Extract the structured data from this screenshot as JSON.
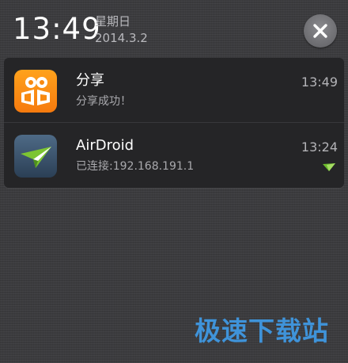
{
  "status": {
    "time": "13:49",
    "weekday": "星期日",
    "date": "2014.3.2"
  },
  "notifications": [
    {
      "app_icon": "kuaibo-share-icon",
      "title": "分享",
      "text": "分享成功！",
      "time": "13:49"
    },
    {
      "app_icon": "airdroid-paper-plane-icon",
      "title": "AirDroid",
      "text": "已连接:192.168.191.1",
      "time": "13:24"
    }
  ],
  "colors": {
    "background": "#3b3b3e",
    "panel": "#252527",
    "share_icon_orange": "#f8890f",
    "airdroid_green": "#6cbb2d",
    "watermark_blue": "#3f93d9"
  },
  "watermark": "极速下载站"
}
